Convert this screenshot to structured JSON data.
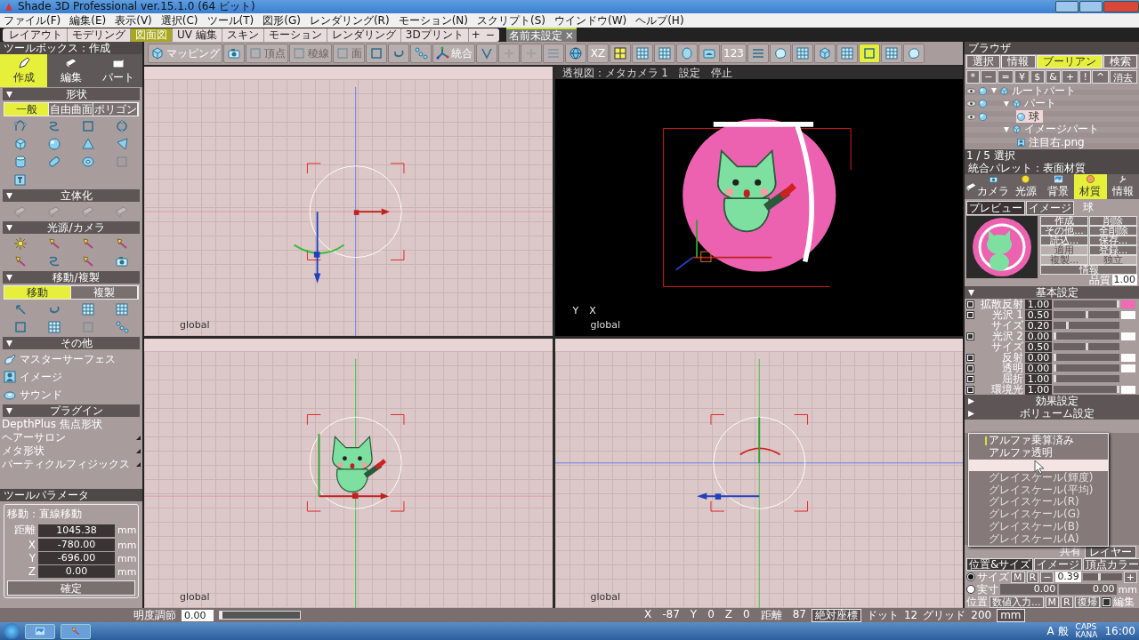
{
  "window": {
    "title": "Shade 3D Professional ver.15.1.0 (64 ビット)"
  },
  "menu": [
    "ファイル(F)",
    "編集(E)",
    "表示(V)",
    "選択(C)",
    "ツール(T)",
    "図形(G)",
    "レンダリング(R)",
    "モーション(N)",
    "スクリプト(S)",
    "ウインドウ(W)",
    "ヘルプ(H)"
  ],
  "layout_tabs": [
    {
      "label": "レイアウト",
      "selected": false
    },
    {
      "label": "モデリング",
      "selected": false
    },
    {
      "label": "図面図",
      "selected": true
    },
    {
      "label": "UV 編集",
      "selected": false
    },
    {
      "label": "スキン",
      "selected": false
    },
    {
      "label": "モーション",
      "selected": false
    },
    {
      "label": "レンダリング",
      "selected": false
    },
    {
      "label": "3Dプリント",
      "selected": false
    }
  ],
  "layout_tab_controls": [
    "+",
    "−"
  ],
  "document_tab": {
    "label": "名前未設定",
    "close": "×"
  },
  "toolbar": [
    {
      "label": "マッピング",
      "disabled": false,
      "selected": false
    },
    {
      "disabled": false,
      "selected": false
    },
    {
      "label": "頂点",
      "disabled": true,
      "selected": false
    },
    {
      "label": "稜線",
      "disabled": true,
      "selected": false
    },
    {
      "label": "面",
      "disabled": true,
      "selected": false
    },
    {
      "disabled": false,
      "selected": false
    },
    {
      "disabled": false,
      "selected": false
    },
    {
      "disabled": false,
      "selected": false
    },
    {
      "label": "統合",
      "disabled": false,
      "selected": false
    },
    {
      "disabled": false,
      "selected": false
    },
    {
      "disabled": true,
      "selected": false
    },
    {
      "disabled": true,
      "selected": false
    },
    {
      "disabled": true,
      "selected": false
    },
    {
      "disabled": false,
      "selected": false
    },
    {
      "label": "XZ",
      "disabled": false,
      "selected": false
    },
    {
      "disabled": false,
      "selected": false
    },
    {
      "disabled": false,
      "selected": false
    },
    {
      "disabled": false,
      "selected": false
    },
    {
      "disabled": false,
      "selected": false
    },
    {
      "disabled": false,
      "selected": false
    },
    {
      "label": "123",
      "disabled": false,
      "selected": false
    },
    {
      "disabled": false,
      "selected": false
    },
    {
      "disabled": false,
      "selected": false
    },
    {
      "disabled": false,
      "selected": false
    },
    {
      "disabled": false,
      "selected": false
    },
    {
      "disabled": false,
      "selected": false
    },
    {
      "disabled": false,
      "selected": true
    },
    {
      "disabled": false,
      "selected": false
    },
    {
      "disabled": false,
      "selected": false
    }
  ],
  "toolbox": {
    "title": "ツールボックス：作成",
    "modes": [
      {
        "label": "作成",
        "selected": true
      },
      {
        "label": "編集",
        "selected": false
      },
      {
        "label": "パート",
        "selected": false
      }
    ],
    "sections": [
      {
        "title": "形状",
        "tabs": [
          {
            "label": "一般",
            "selected": true
          },
          {
            "label": "自由曲面",
            "selected": false
          },
          {
            "label": "ポリゴン",
            "selected": false
          }
        ],
        "tools": [
          {
            "disabled": false
          },
          {
            "disabled": false
          },
          {
            "disabled": false
          },
          {
            "disabled": false
          },
          {
            "disabled": false
          },
          {
            "disabled": false
          },
          {
            "disabled": false
          },
          {
            "disabled": false
          },
          {
            "disabled": false
          },
          {
            "disabled": false
          },
          {
            "disabled": false
          },
          {
            "disabled": true
          },
          {
            "disabled": false
          }
        ]
      },
      {
        "title": "立体化",
        "tools": [
          {
            "disabled": true
          },
          {
            "disabled": true
          },
          {
            "disabled": true
          },
          {
            "disabled": true
          }
        ]
      },
      {
        "title": "光源/カメラ",
        "tools": [
          {
            "disabled": false
          },
          {
            "disabled": false
          },
          {
            "disabled": false
          },
          {
            "disabled": false
          },
          {
            "disabled": false
          },
          {
            "disabled": false
          },
          {
            "disabled": false
          },
          {
            "disabled": false
          }
        ]
      },
      {
        "title": "移動/複製",
        "tabs": [
          {
            "label": "移動",
            "selected": true
          },
          {
            "label": "複製",
            "selected": false
          }
        ],
        "tools": [
          {
            "disabled": false
          },
          {
            "disabled": false
          },
          {
            "disabled": false
          },
          {
            "disabled": false
          },
          {
            "disabled": false
          },
          {
            "disabled": false
          },
          {
            "disabled": true
          },
          {
            "disabled": false
          }
        ]
      },
      {
        "title": "その他",
        "items": [
          "マスターサーフェス",
          "イメージ",
          "サウンド"
        ]
      },
      {
        "title": "プラグイン",
        "plugins": [
          {
            "label": "DepthPlus 焦点形状",
            "submenu": false
          },
          {
            "label": "ヘアーサロン",
            "submenu": true
          },
          {
            "label": "メタ形状",
            "submenu": true
          },
          {
            "label": "パーティクルフィジックス",
            "submenu": true
          }
        ]
      }
    ]
  },
  "tool_parameters": {
    "title": "ツールパラメータ",
    "group": "移動：直線移動",
    "fields": [
      {
        "label": "距離",
        "value": "1045.38",
        "unit": "mm"
      },
      {
        "label": "X",
        "value": "-780.00",
        "unit": "mm"
      },
      {
        "label": "Y",
        "value": "-696.00",
        "unit": "mm"
      },
      {
        "label": "Z",
        "value": "0.00",
        "unit": "mm"
      }
    ],
    "button": "確定"
  },
  "viewports": [
    {
      "kind": "top",
      "label": "global"
    },
    {
      "kind": "perspective",
      "title": "透視図：メタカメラ 1",
      "menus": [
        "設定",
        "停止"
      ],
      "axis_labels": [
        "Y",
        "X"
      ],
      "label": "global"
    },
    {
      "kind": "front",
      "label": "global"
    },
    {
      "kind": "side",
      "label": "global"
    }
  ],
  "browser": {
    "title": "ブラウザ",
    "tabs": [
      {
        "label": "選択",
        "selected": false
      },
      {
        "label": "情報",
        "selected": false
      },
      {
        "label": "ブーリアン",
        "selected": true
      },
      {
        "label": "検索",
        "selected": false
      }
    ],
    "operators": [
      "*",
      "−",
      "=",
      "¥",
      "$",
      "&",
      "+",
      "!",
      "^"
    ],
    "clear": "消去",
    "tree": [
      {
        "label": "ルートパート",
        "kind": "part",
        "visible": true,
        "expanded": true,
        "selected": false,
        "children": [
          {
            "label": "パート",
            "kind": "part",
            "visible": true,
            "expanded": true,
            "selected": false,
            "children": [
              {
                "label": "球",
                "kind": "sphere",
                "visible": true,
                "selected": true
              }
            ]
          },
          {
            "label": "イメージパート",
            "kind": "part",
            "visible": false,
            "expanded": true,
            "selected": false,
            "children": [
              {
                "label": "注目右.png",
                "kind": "image",
                "visible": false,
                "selected": false
              }
            ]
          }
        ]
      }
    ],
    "status": "1 / 5 選択"
  },
  "palette": {
    "title": "統合パレット：表面材質",
    "tabs": [
      {
        "label": "カメラ",
        "selected": false
      },
      {
        "label": "光源",
        "selected": false
      },
      {
        "label": "背景",
        "selected": false
      },
      {
        "label": "材質",
        "selected": true
      },
      {
        "label": "情報",
        "selected": false
      }
    ],
    "preview_tabs": [
      {
        "label": "プレビュー",
        "selected": true
      },
      {
        "label": "イメージ",
        "selected": false
      }
    ],
    "material_name": "球",
    "buttons": [
      {
        "label": "作成",
        "disabled": false
      },
      {
        "label": "削除",
        "disabled": false
      },
      {
        "label": "その他...",
        "disabled": false
      },
      {
        "label": "全削除",
        "disabled": false
      },
      {
        "label": "読込...",
        "disabled": false
      },
      {
        "label": "保存...",
        "disabled": false
      },
      {
        "label": "適用",
        "disabled": true
      },
      {
        "label": "登録...",
        "disabled": false
      },
      {
        "label": "複製...",
        "disabled": true
      },
      {
        "label": "独立",
        "disabled": true
      }
    ],
    "info_button": "情報",
    "quality": {
      "label": "品質",
      "value": "1.00"
    },
    "basic_title": "基本設定",
    "rows": [
      {
        "kind": "main",
        "label": "拡散反射",
        "value": "1.00",
        "level": 1.0,
        "checked": true,
        "color": "#f06ab4"
      },
      {
        "kind": "main",
        "label": "光沢 1",
        "value": "0.50",
        "level": 0.5,
        "checked": true,
        "color": "#ffffff"
      },
      {
        "kind": "sub",
        "label": "サイズ",
        "value": "0.20",
        "level": 0.2
      },
      {
        "kind": "main",
        "label": "光沢 2",
        "value": "0.00",
        "level": 0.0,
        "checked": true,
        "color": "#ffffff"
      },
      {
        "kind": "sub",
        "label": "サイズ",
        "value": "0.50",
        "level": 0.5
      },
      {
        "kind": "main",
        "label": "反射",
        "value": "0.00",
        "level": 0.0,
        "checked": true,
        "color": "#ffffff"
      },
      {
        "kind": "main",
        "label": "透明",
        "value": "0.00",
        "level": 0.0,
        "checked": true,
        "color": "#ffffff"
      },
      {
        "kind": "main",
        "label": "屈折",
        "value": "1.00",
        "level": 0.0,
        "checked": true
      },
      {
        "kind": "main",
        "label": "環境光",
        "value": "1.00",
        "level": 1.0,
        "checked": true,
        "color": "#ffffff"
      }
    ],
    "collapsed_sections": [
      "効果設定",
      "ボリューム設定"
    ],
    "shared": {
      "label": "共有",
      "button": "レイヤー"
    },
    "bottom_tabs": [
      {
        "label": "位置&サイズ",
        "selected": true
      },
      {
        "label": "イメージ",
        "selected": false
      },
      {
        "label": "頂点カラー",
        "selected": false
      }
    ],
    "size_modes": [
      {
        "label": "サイズ",
        "selected": true
      },
      {
        "label": "実寸",
        "selected": false
      }
    ],
    "size_buttons": [
      "M",
      "R",
      "−"
    ],
    "size": {
      "value": "0.39",
      "level": 0.4
    },
    "size_plus": "+",
    "actual_values": [
      "0.00",
      "0.00"
    ],
    "actual_unit": "mm",
    "position_label": "位置",
    "position_buttons": [
      "数値入力...",
      "M",
      "R",
      "復帰"
    ],
    "edit_check": {
      "label": "編集",
      "checked": true
    }
  },
  "popup_menu": [
    {
      "label": "アルファ乗算済み",
      "checked": true,
      "selected": false,
      "disabled": false
    },
    {
      "label": "アルファ透明",
      "checked": false,
      "selected": false,
      "disabled": false
    },
    {
      "checked": false,
      "selected": true,
      "disabled": false
    },
    {
      "label": "グレイスケール(輝度)",
      "checked": false,
      "selected": false,
      "disabled": true
    },
    {
      "label": "グレイスケール(平均)",
      "checked": false,
      "selected": false,
      "disabled": true
    },
    {
      "label": "グレイスケール(R)",
      "checked": false,
      "selected": false,
      "disabled": true
    },
    {
      "label": "グレイスケール(G)",
      "checked": false,
      "selected": false,
      "disabled": true
    },
    {
      "label": "グレイスケール(B)",
      "checked": false,
      "selected": false,
      "disabled": true
    },
    {
      "label": "グレイスケール(A)",
      "checked": false,
      "selected": false,
      "disabled": true
    }
  ],
  "status_bar": {
    "brightness": {
      "label": "明度調節",
      "value": "0.00",
      "level": 0.0
    },
    "coords": [
      {
        "label": "X",
        "value": "-87"
      },
      {
        "label": "Y",
        "value": "0"
      },
      {
        "label": "Z",
        "value": "0"
      },
      {
        "label": "距離",
        "value": "87"
      }
    ],
    "coord_mode": "絶対座標",
    "dot": {
      "label": "ドット",
      "value": "12"
    },
    "grid": {
      "label": "グリッド",
      "value": "200"
    },
    "unit": "mm"
  },
  "taskbar": {
    "ime": "A 般",
    "caps": "CAPS",
    "kana": "KANA",
    "clock": "16:00"
  }
}
